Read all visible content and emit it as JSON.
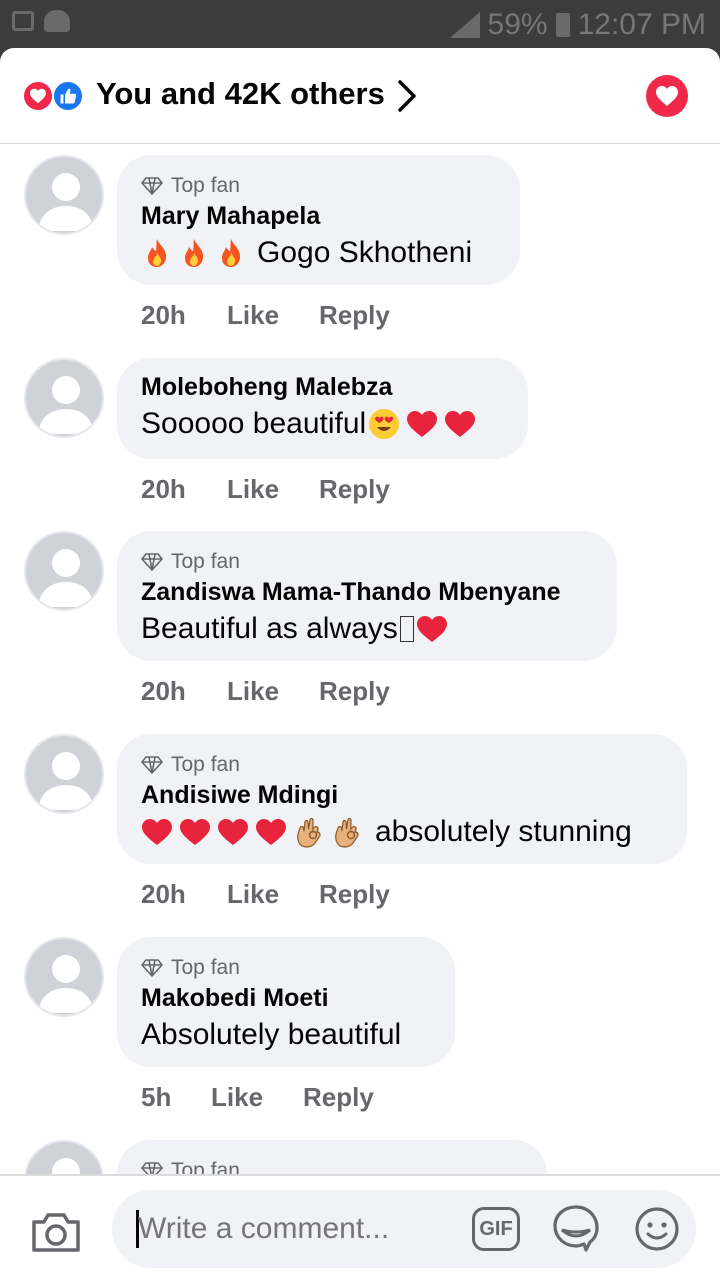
{
  "status_bar": {
    "battery": "59%",
    "time": "12:07 PM"
  },
  "header": {
    "reactions_summary": "You and 42K others",
    "reaction_icons": [
      "heart-icon",
      "like-icon"
    ]
  },
  "comments": [
    {
      "top_fan": true,
      "badge": "Top fan",
      "author": "Mary Mahapela",
      "emojis_before": [
        "fire",
        "fire",
        "fire"
      ],
      "text": "Gogo Skhotheni",
      "time": "20h",
      "like": "Like",
      "reply": "Reply"
    },
    {
      "top_fan": false,
      "author": "Moleboheng Malebza",
      "text": "Sooooo beautiful",
      "emojis_after": [
        "heart-eyes",
        "red-heart",
        "red-heart"
      ],
      "time": "20h",
      "like": "Like",
      "reply": "Reply"
    },
    {
      "top_fan": true,
      "badge": "Top fan",
      "author": "Zandiswa Mama-Thando Mbenyane",
      "text": "Beautiful as always",
      "emojis_after": [
        "unrendered-glyph",
        "red-heart"
      ],
      "time": "20h",
      "like": "Like",
      "reply": "Reply"
    },
    {
      "top_fan": true,
      "badge": "Top fan",
      "author": "Andisiwe Mdingi",
      "emojis_before": [
        "red-heart",
        "red-heart",
        "red-heart",
        "red-heart",
        "ok-hand",
        "ok-hand"
      ],
      "text": "absolutely stunning",
      "time": "20h",
      "like": "Like",
      "reply": "Reply"
    },
    {
      "top_fan": true,
      "badge": "Top fan",
      "author": "Makobedi Moeti",
      "text": "Absolutely beautiful",
      "time": "5h",
      "like": "Like",
      "reply": "Reply"
    },
    {
      "top_fan": true,
      "badge": "Top fan",
      "partial": true
    }
  ],
  "composer": {
    "placeholder": "Write a comment...",
    "gif_label": "GIF"
  },
  "colors": {
    "reaction_heart": "#f0284a",
    "reaction_like": "#1a77f2",
    "bubble_bg": "#f0f2f5",
    "secondary_text": "#65676b"
  }
}
